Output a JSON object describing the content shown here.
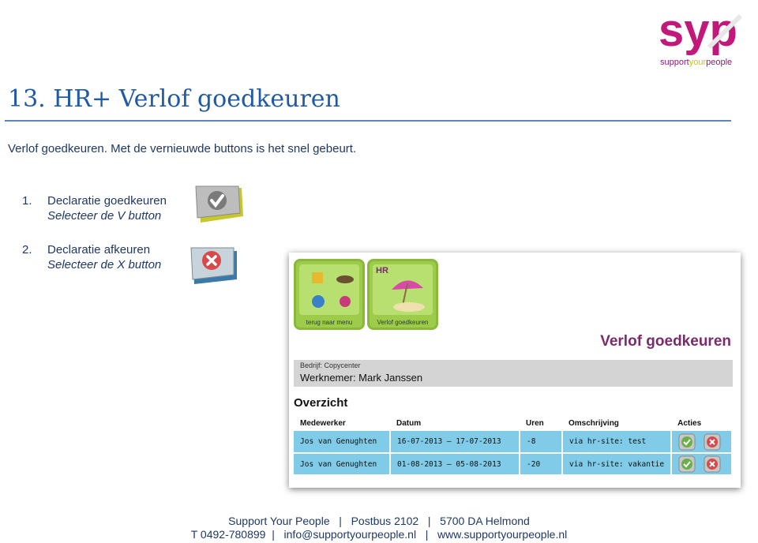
{
  "logo": {
    "text": "syp",
    "tagline_a": "support",
    "tagline_b": "your",
    "tagline_c": "people"
  },
  "title": "13.  HR+ Verlof goedkeuren",
  "intro": "Verlof goedkeuren. Met de vernieuwde buttons is het snel gebeurt.",
  "steps": [
    {
      "num": "1.",
      "label": "Declaratie goedkeuren",
      "sub": "Selecteer de V button",
      "icon": "check-button-icon"
    },
    {
      "num": "2.",
      "label": "Declaratie afkeuren",
      "sub": "Selecteer de X button",
      "icon": "x-button-icon"
    }
  ],
  "screenshot": {
    "tiles": [
      {
        "caption": "terug naar menu"
      },
      {
        "caption": "Verlof goedkeuren",
        "badge": "HR"
      }
    ],
    "heading": "Verlof goedkeuren",
    "bedrijf": "Bedrijf: Copycenter",
    "werknemer": "Werknemer: Mark Janssen",
    "overzicht": "Overzicht",
    "columns": [
      "Medewerker",
      "Datum",
      "Uren",
      "Omschrijving",
      "Acties"
    ],
    "rows": [
      {
        "medewerker": "Jos van Genughten",
        "datum": "16-07-2013 – 17-07-2013",
        "uren": "-8",
        "omschrijving": "via hr-site: test"
      },
      {
        "medewerker": "Jos van Genughten",
        "datum": "01-08-2013 – 05-08-2013",
        "uren": "-20",
        "omschrijving": "via hr-site: vakantie"
      }
    ]
  },
  "footer": {
    "line1": "Support Your People   |   Postbus 2102   |   5700 DA Helmond",
    "line2": "T 0492-780899  |   info@supportyourpeople.nl   |   www.supportyourpeople.nl"
  },
  "colors": {
    "accent": "#1f5aa8",
    "brand": "#c2187a",
    "row": "#7fcbe8",
    "tile": "#9ccc4a"
  }
}
